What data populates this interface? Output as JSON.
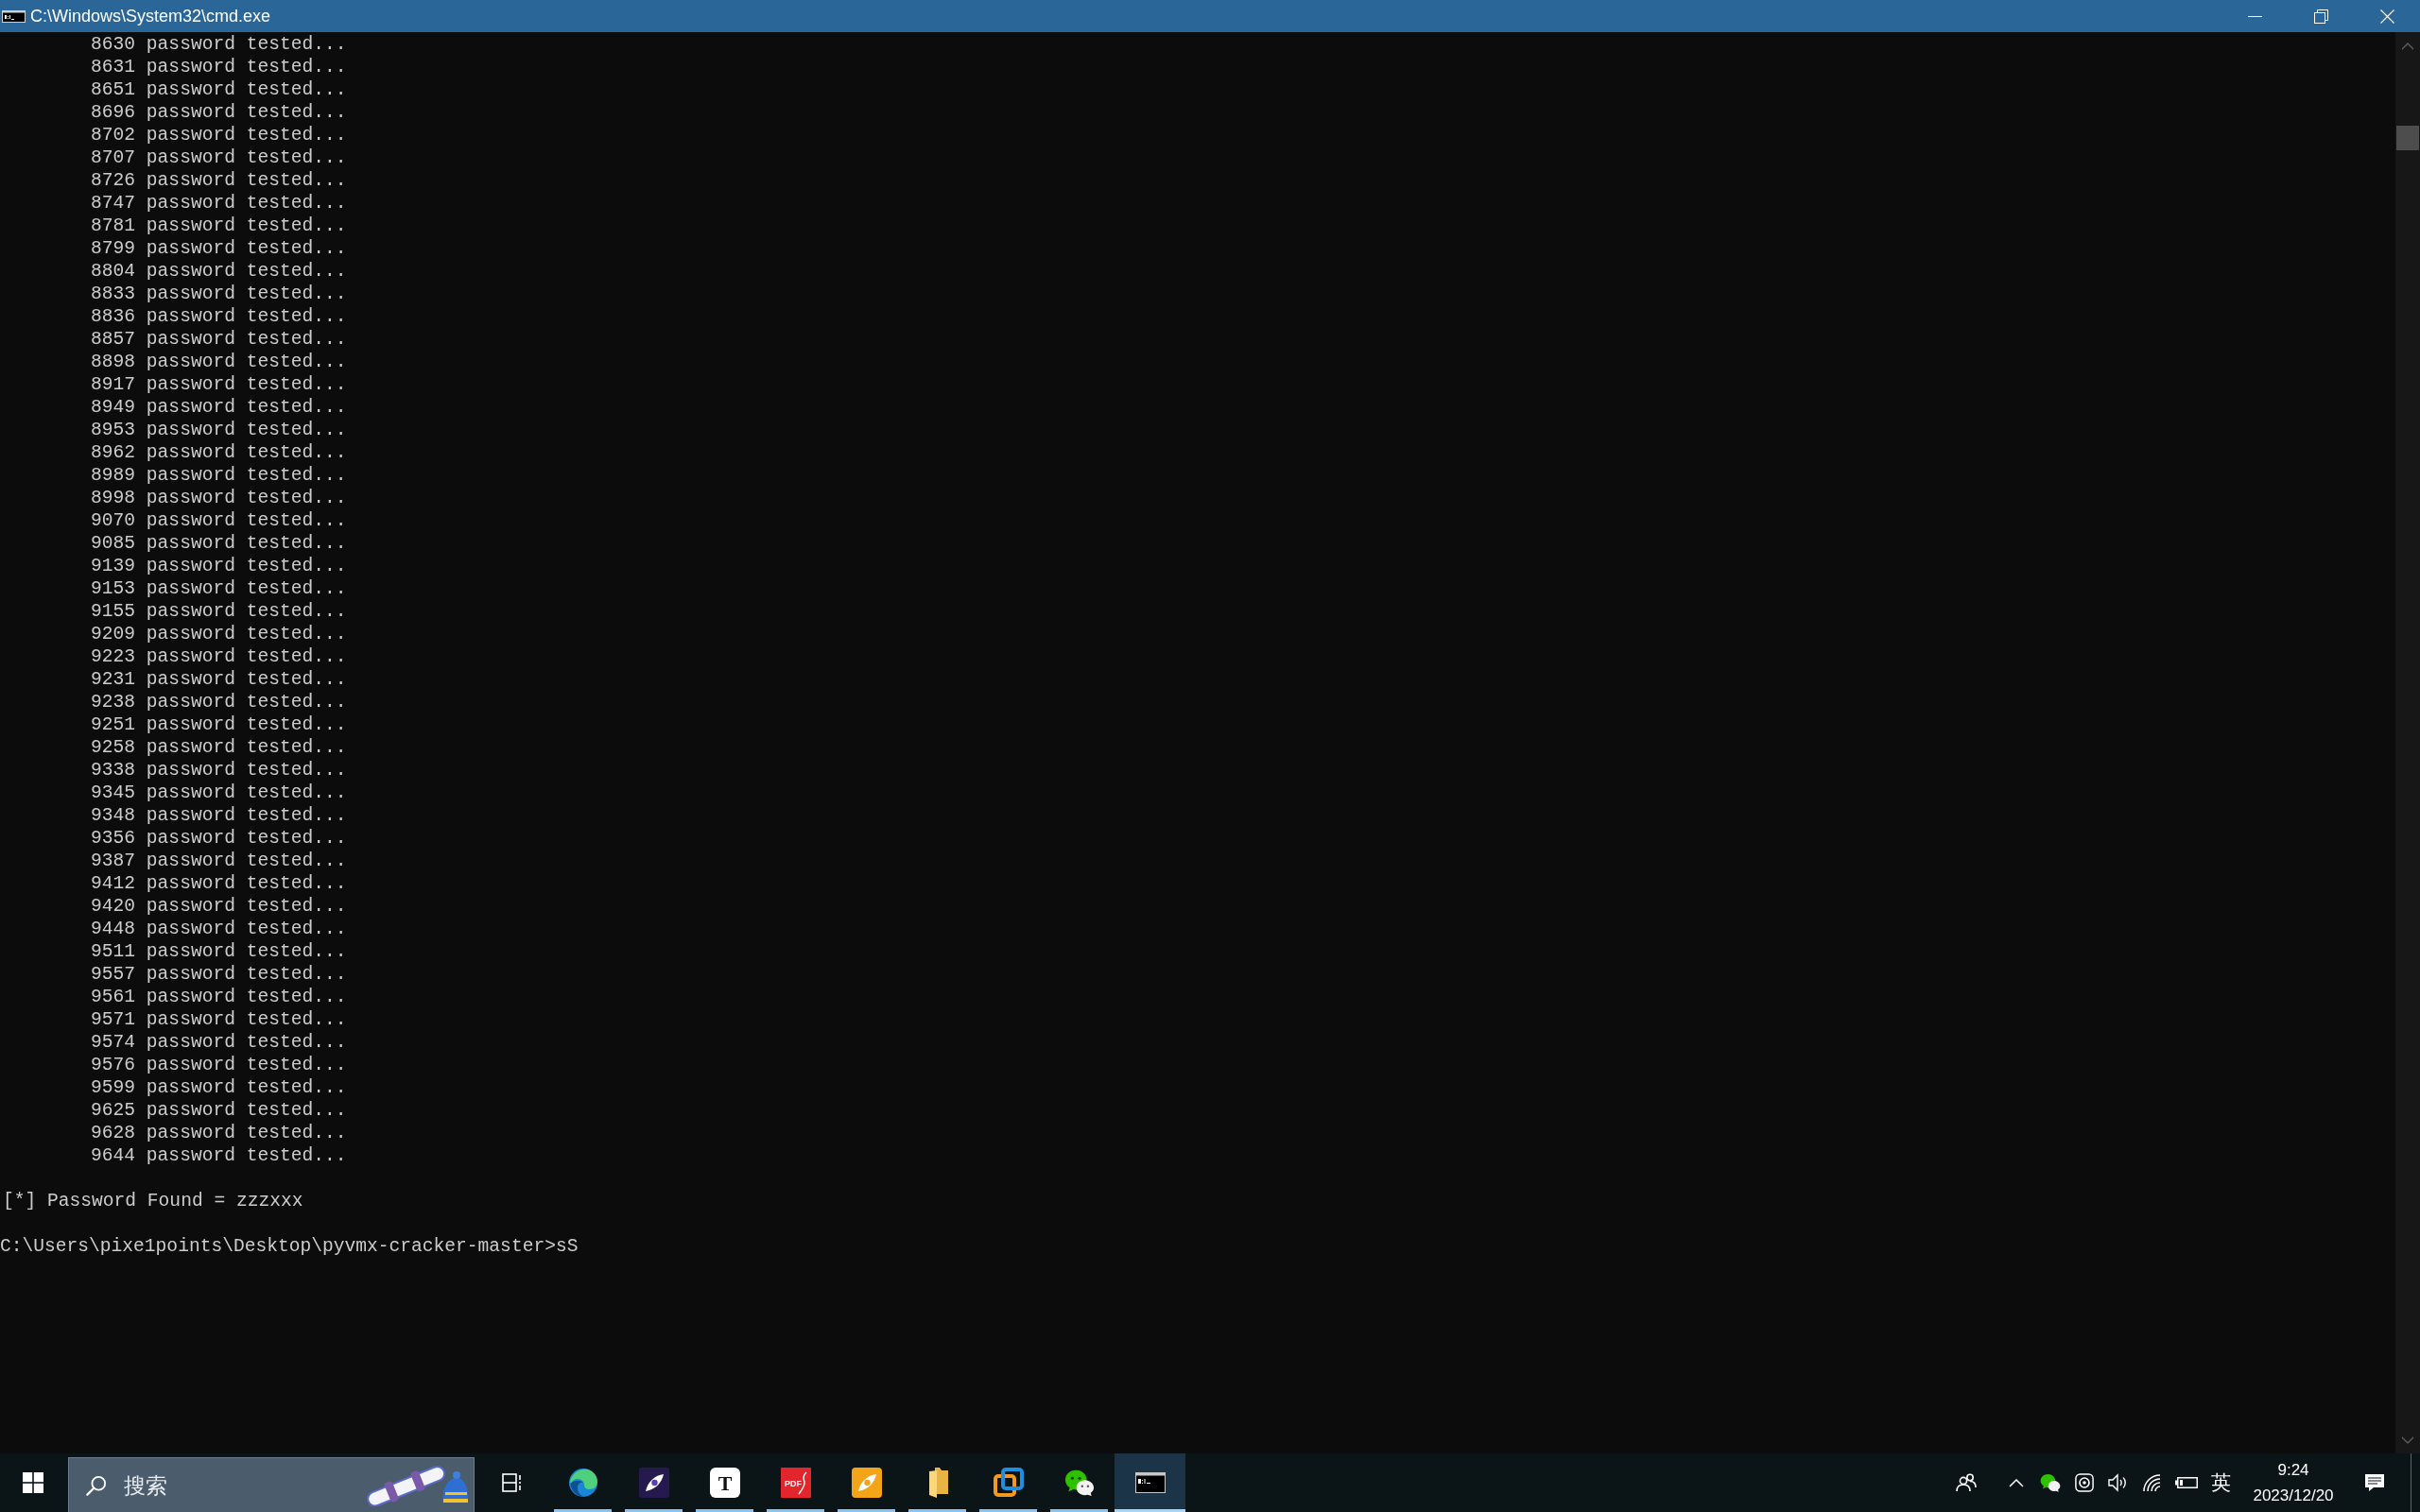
{
  "window": {
    "title": "C:\\Windows\\System32\\cmd.exe"
  },
  "console": {
    "progress_lines": [
      "8630 password tested...",
      "8631 password tested...",
      "8651 password tested...",
      "8696 password tested...",
      "8702 password tested...",
      "8707 password tested...",
      "8726 password tested...",
      "8747 password tested...",
      "8781 password tested...",
      "8799 password tested...",
      "8804 password tested...",
      "8833 password tested...",
      "8836 password tested...",
      "8857 password tested...",
      "8898 password tested...",
      "8917 password tested...",
      "8949 password tested...",
      "8953 password tested...",
      "8962 password tested...",
      "8989 password tested...",
      "8998 password tested...",
      "9070 password tested...",
      "9085 password tested...",
      "9139 password tested...",
      "9153 password tested...",
      "9155 password tested...",
      "9209 password tested...",
      "9223 password tested...",
      "9231 password tested...",
      "9238 password tested...",
      "9251 password tested...",
      "9258 password tested...",
      "9338 password tested...",
      "9345 password tested...",
      "9348 password tested...",
      "9356 password tested...",
      "9387 password tested...",
      "9412 password tested...",
      "9420 password tested...",
      "9448 password tested...",
      "9511 password tested...",
      "9557 password tested...",
      "9561 password tested...",
      "9571 password tested...",
      "9574 password tested...",
      "9576 password tested...",
      "9599 password tested...",
      "9625 password tested...",
      "9628 password tested...",
      "9644 password tested..."
    ],
    "result_line": "[*] Password Found = zzzxxx",
    "prompt_line": "C:\\Users\\pixe1points\\Desktop\\pyvmx-cracker-master>sS"
  },
  "taskbar": {
    "search": {
      "placeholder": "搜索"
    },
    "apps": [
      {
        "kind": "swirl",
        "running": true,
        "selected": false
      },
      {
        "kind": "quill-purple",
        "running": true,
        "selected": false
      },
      {
        "kind": "letter-tile",
        "label": "T",
        "running": true,
        "selected": false
      },
      {
        "kind": "pdf-tile",
        "label": "PDF",
        "running": true,
        "selected": false
      },
      {
        "kind": "quill-orange",
        "running": true,
        "selected": false
      },
      {
        "kind": "folder",
        "running": true,
        "selected": false
      },
      {
        "kind": "squares",
        "running": true,
        "selected": false
      },
      {
        "kind": "chat",
        "running": true,
        "selected": false
      },
      {
        "kind": "terminal",
        "running": true,
        "selected": true
      }
    ],
    "tray": {
      "ime": "英",
      "time": "9:24",
      "date": "2023/12/20"
    }
  }
}
